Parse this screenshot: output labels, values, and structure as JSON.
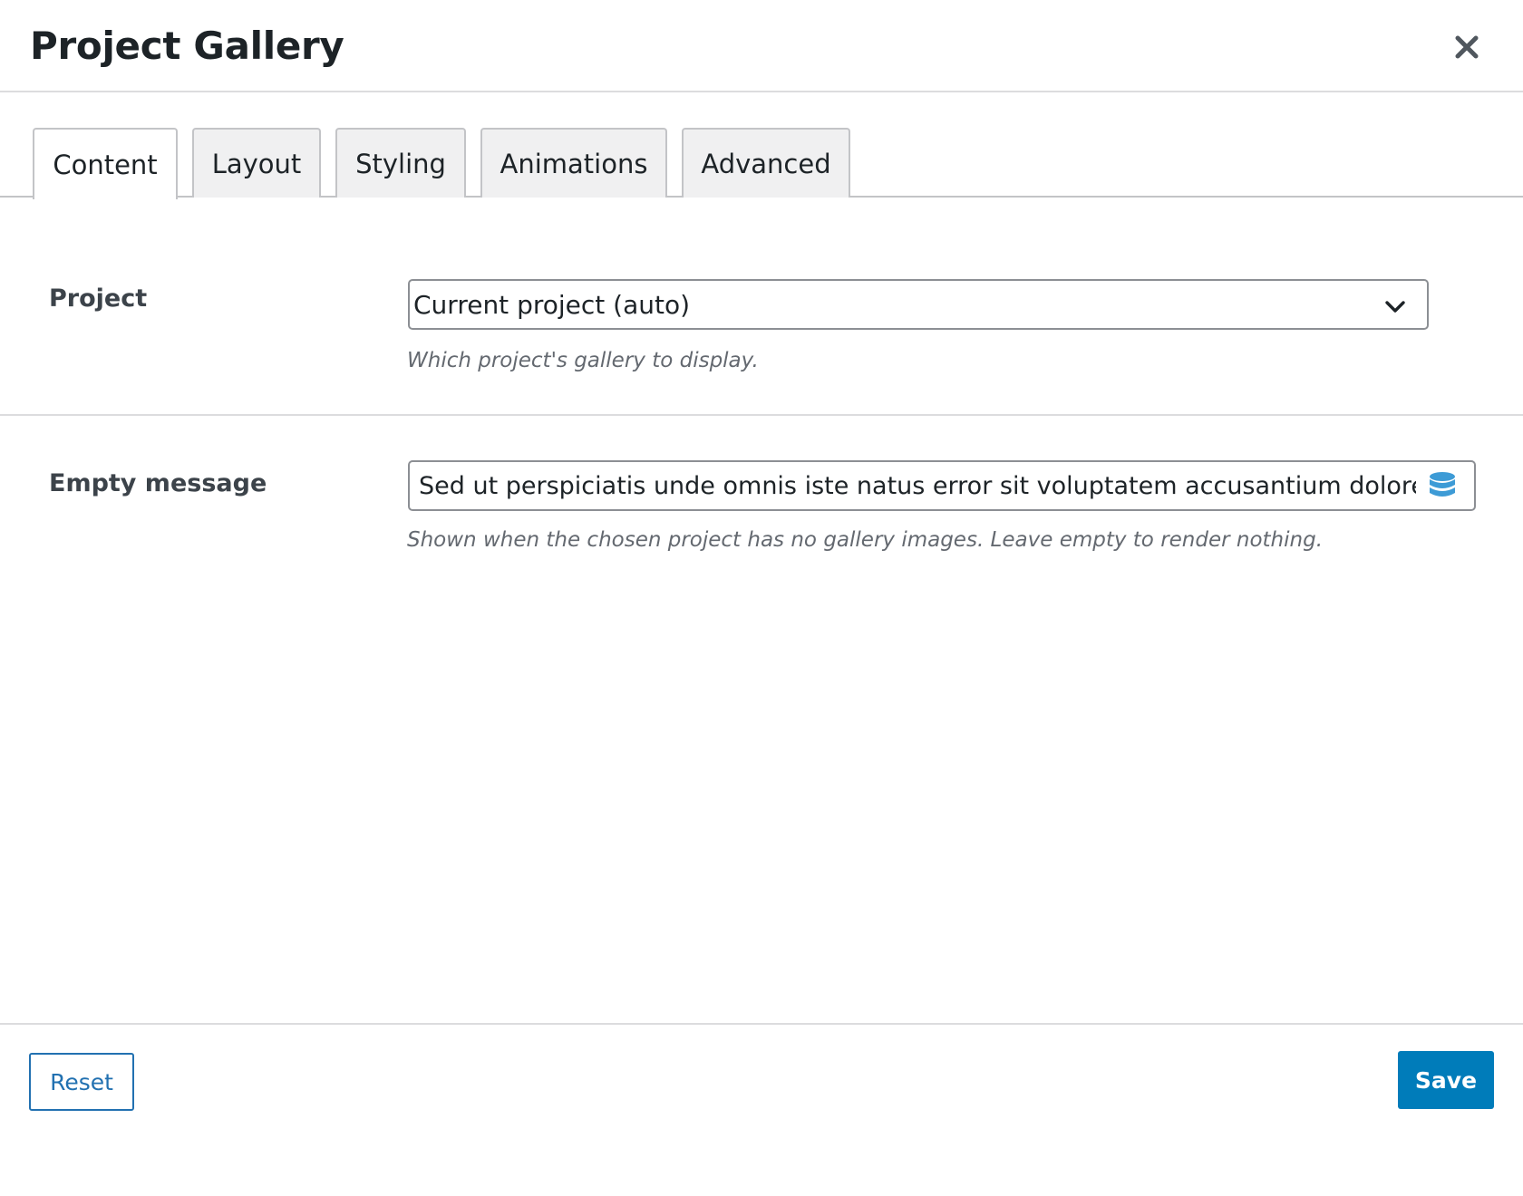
{
  "modal": {
    "title": "Project Gallery"
  },
  "tabs": [
    {
      "label": "Content",
      "active": true
    },
    {
      "label": "Layout",
      "active": false
    },
    {
      "label": "Styling",
      "active": false
    },
    {
      "label": "Animations",
      "active": false
    },
    {
      "label": "Advanced",
      "active": false
    }
  ],
  "fields": {
    "project": {
      "label": "Project",
      "value": "Current project (auto)",
      "help": "Which project's gallery to display."
    },
    "empty_message": {
      "label": "Empty message",
      "value": "Sed ut perspiciatis unde omnis iste natus error sit voluptatem accusantium doloremque laudantium",
      "help": "Shown when the chosen project has no gallery images. Leave empty to render nothing."
    }
  },
  "footer": {
    "reset_label": "Reset",
    "save_label": "Save"
  },
  "icons": {
    "close": "close-icon",
    "chevron": "chevron-down-icon",
    "dynamic_data": "database-icon"
  },
  "colors": {
    "primary": "#007cba",
    "secondary_text": "#2271b1",
    "database_icon": "#3d9bd6"
  }
}
